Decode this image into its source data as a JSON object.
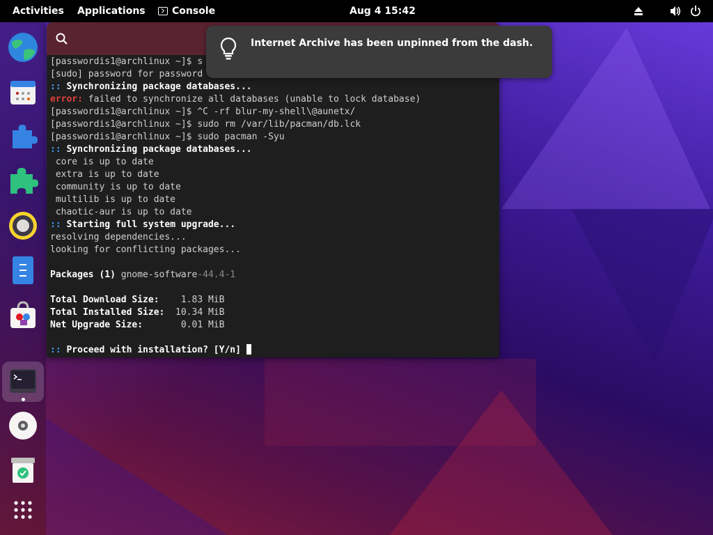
{
  "topbar": {
    "activities": "Activities",
    "applications": "Applications",
    "app_name": "Console",
    "clock": "Aug 4  15:42"
  },
  "dock": {
    "items": [
      {
        "name": "Web Browser",
        "icon": "globe-icon"
      },
      {
        "name": "Calendar",
        "icon": "calendar-icon"
      },
      {
        "name": "Extensions",
        "icon": "puzzle-icon"
      },
      {
        "name": "Extension Manager",
        "icon": "puzzle-green-icon"
      },
      {
        "name": "Rhythmbox",
        "icon": "speaker-icon"
      },
      {
        "name": "Text Editor",
        "icon": "text-editor-icon"
      },
      {
        "name": "Software",
        "icon": "shopping-bag-icon"
      },
      {
        "name": "Console",
        "icon": "terminal-icon"
      },
      {
        "name": "Disc",
        "icon": "disc-icon"
      },
      {
        "name": "Trash",
        "icon": "trash-icon"
      },
      {
        "name": "Show Apps",
        "icon": "app-grid-icon"
      }
    ]
  },
  "terminal": {
    "lines": [
      {
        "prompt": "[passwordis1@archlinux ~]$ ",
        "text": "s"
      },
      {
        "text": "[sudo] password for password"
      },
      {
        "marker": ":: ",
        "bold": "Synchronizing package databases..."
      },
      {
        "error": "error:",
        "text": " failed to synchronize all databases (unable to lock database)"
      },
      {
        "prompt": "[passwordis1@archlinux ~]$ ",
        "text": "^C -rf blur-my-shell\\@aunetx/"
      },
      {
        "prompt": "[passwordis1@archlinux ~]$ ",
        "text": "sudo rm /var/lib/pacman/db.lck"
      },
      {
        "prompt": "[passwordis1@archlinux ~]$ ",
        "text": "sudo pacman -Syu"
      },
      {
        "marker": ":: ",
        "bold": "Synchronizing package databases..."
      },
      {
        "text": " core is up to date"
      },
      {
        "text": " extra is up to date"
      },
      {
        "text": " community is up to date"
      },
      {
        "text": " multilib is up to date"
      },
      {
        "text": " chaotic-aur is up to date"
      },
      {
        "marker": ":: ",
        "bold": "Starting full system upgrade..."
      },
      {
        "text": "resolving dependencies..."
      },
      {
        "text": "looking for conflicting packages..."
      },
      {
        "text": ""
      },
      {
        "bold": "Packages (1) ",
        "text": "gnome-software",
        "dim": "-44.4-1"
      },
      {
        "text": ""
      },
      {
        "bold": "Total Download Size:  ",
        "text": "  1.83 MiB"
      },
      {
        "bold": "Total Installed Size:",
        "text": "  10.34 MiB"
      },
      {
        "bold": "Net Upgrade Size:     ",
        "text": "  0.01 MiB"
      },
      {
        "text": ""
      },
      {
        "marker": ":: ",
        "bold": "Proceed with installation? [Y/n] "
      }
    ]
  },
  "notification": {
    "text": "Internet Archive has been unpinned from the dash."
  }
}
